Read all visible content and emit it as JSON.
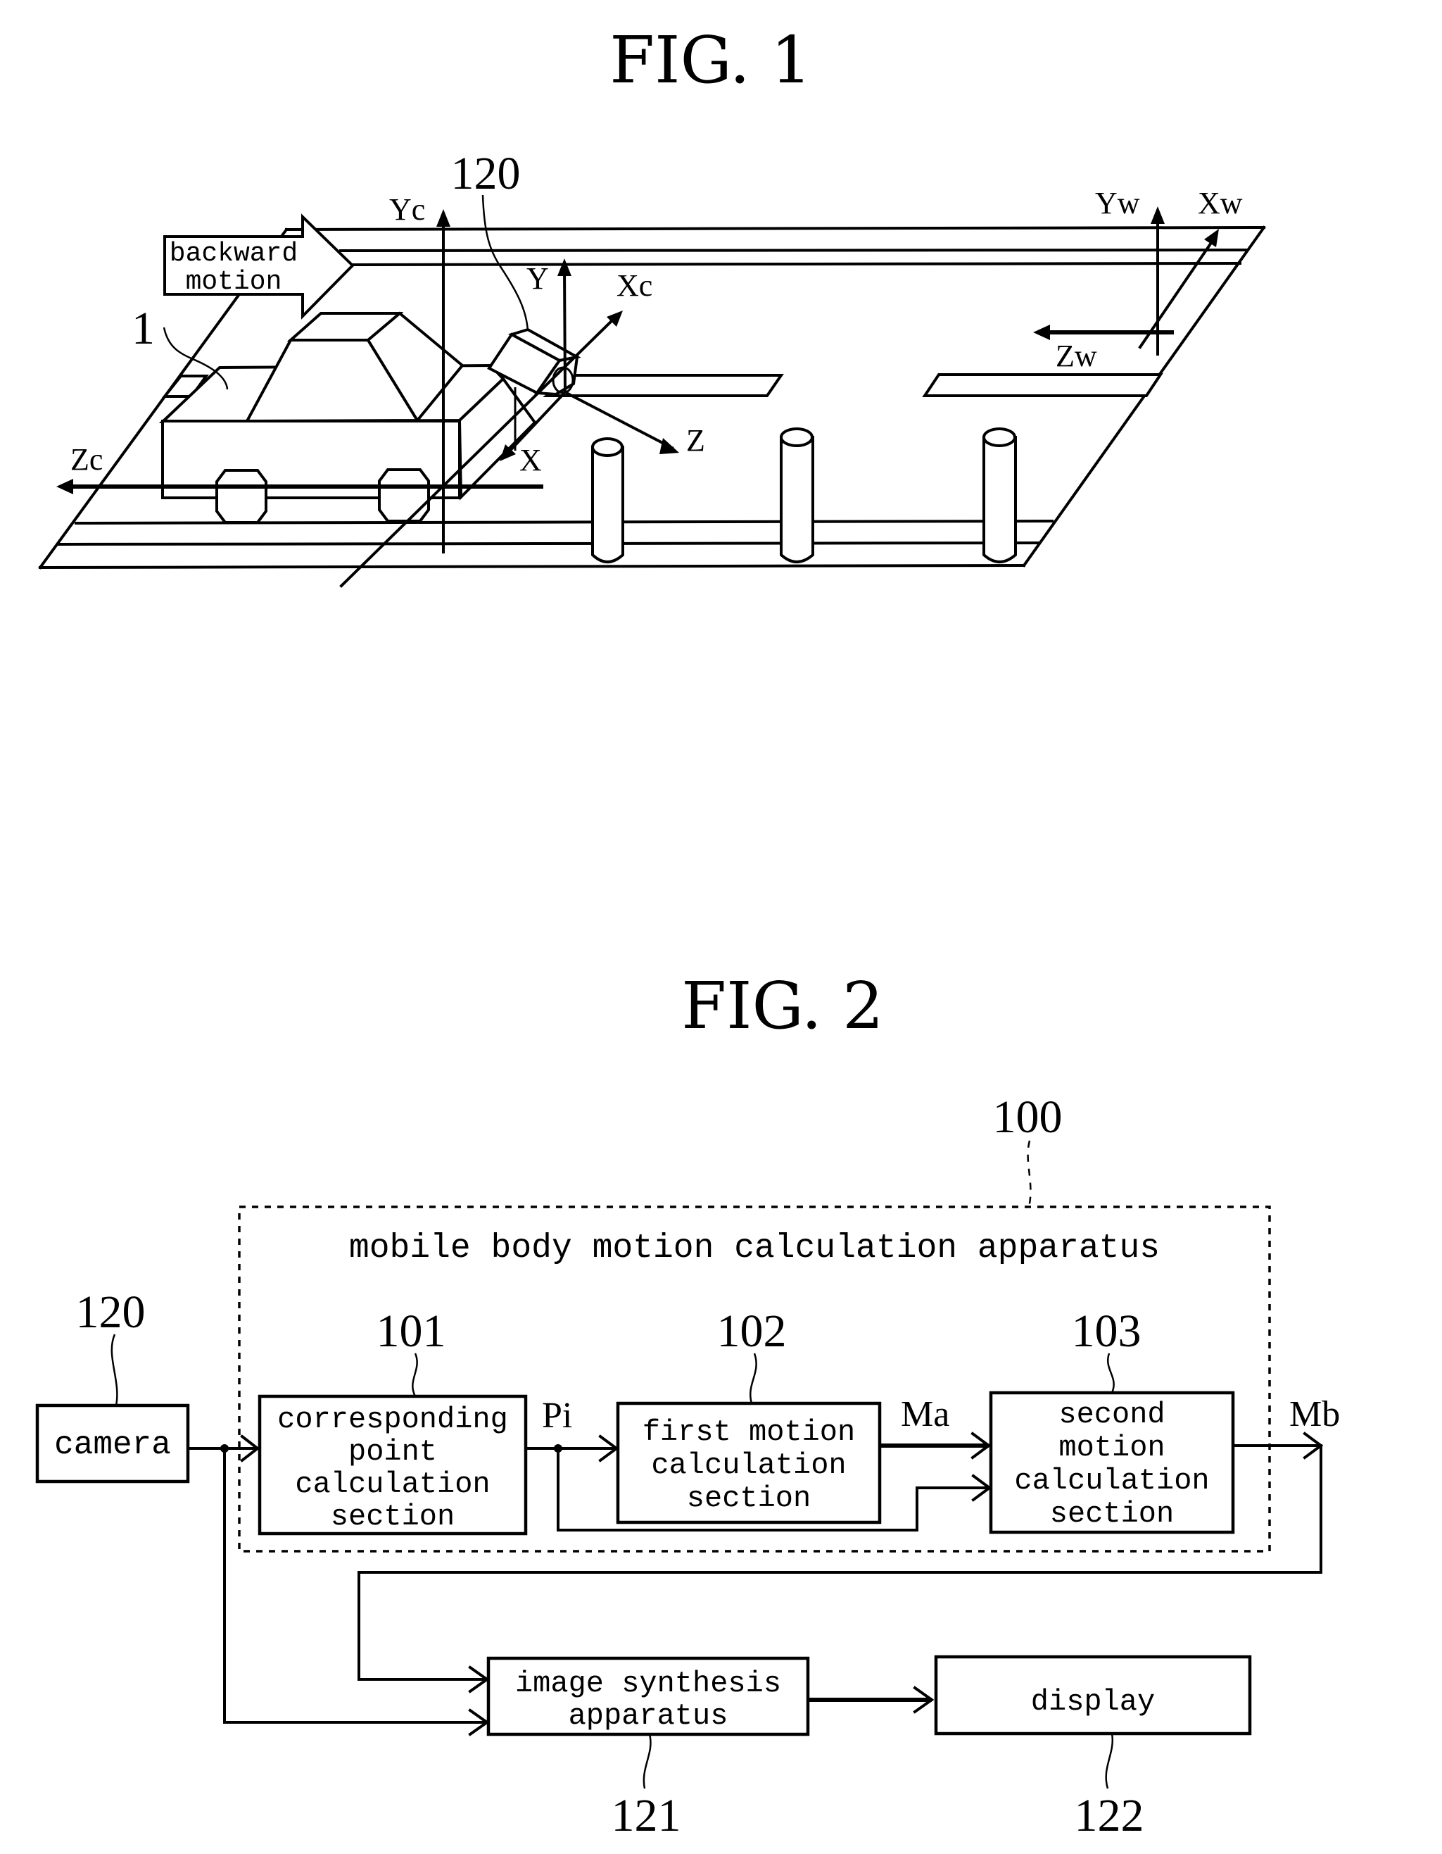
{
  "figure1": {
    "title": "FIG. 1",
    "ref_vehicle": "1",
    "ref_camera": "120",
    "arrow_label_line1": "backward",
    "arrow_label_line2": "motion",
    "axes": {
      "Yc": "Yc",
      "Zc": "Zc",
      "Xc": "Xc",
      "Y": "Y",
      "X": "X",
      "Z": "Z",
      "Yw": "Yw",
      "Xw": "Xw",
      "Zw": "Zw"
    }
  },
  "figure2": {
    "title": "FIG. 2",
    "apparatus_ref": "100",
    "apparatus_label": "mobile body motion calculation apparatus",
    "camera": {
      "ref": "120",
      "label": "camera"
    },
    "blocks": [
      {
        "ref": "101",
        "lines": [
          "corresponding",
          "point",
          "calculation",
          "section"
        ]
      },
      {
        "ref": "102",
        "lines": [
          "first motion",
          "calculation",
          "section"
        ]
      },
      {
        "ref": "103",
        "lines": [
          "second",
          "motion",
          "calculation",
          "section"
        ]
      }
    ],
    "image_synthesis": {
      "ref": "121",
      "lines": [
        "image synthesis",
        "apparatus"
      ]
    },
    "display": {
      "ref": "122",
      "label": "display"
    },
    "signals": {
      "Pi": "Pi",
      "Ma": "Ma",
      "Mb": "Mb"
    }
  }
}
